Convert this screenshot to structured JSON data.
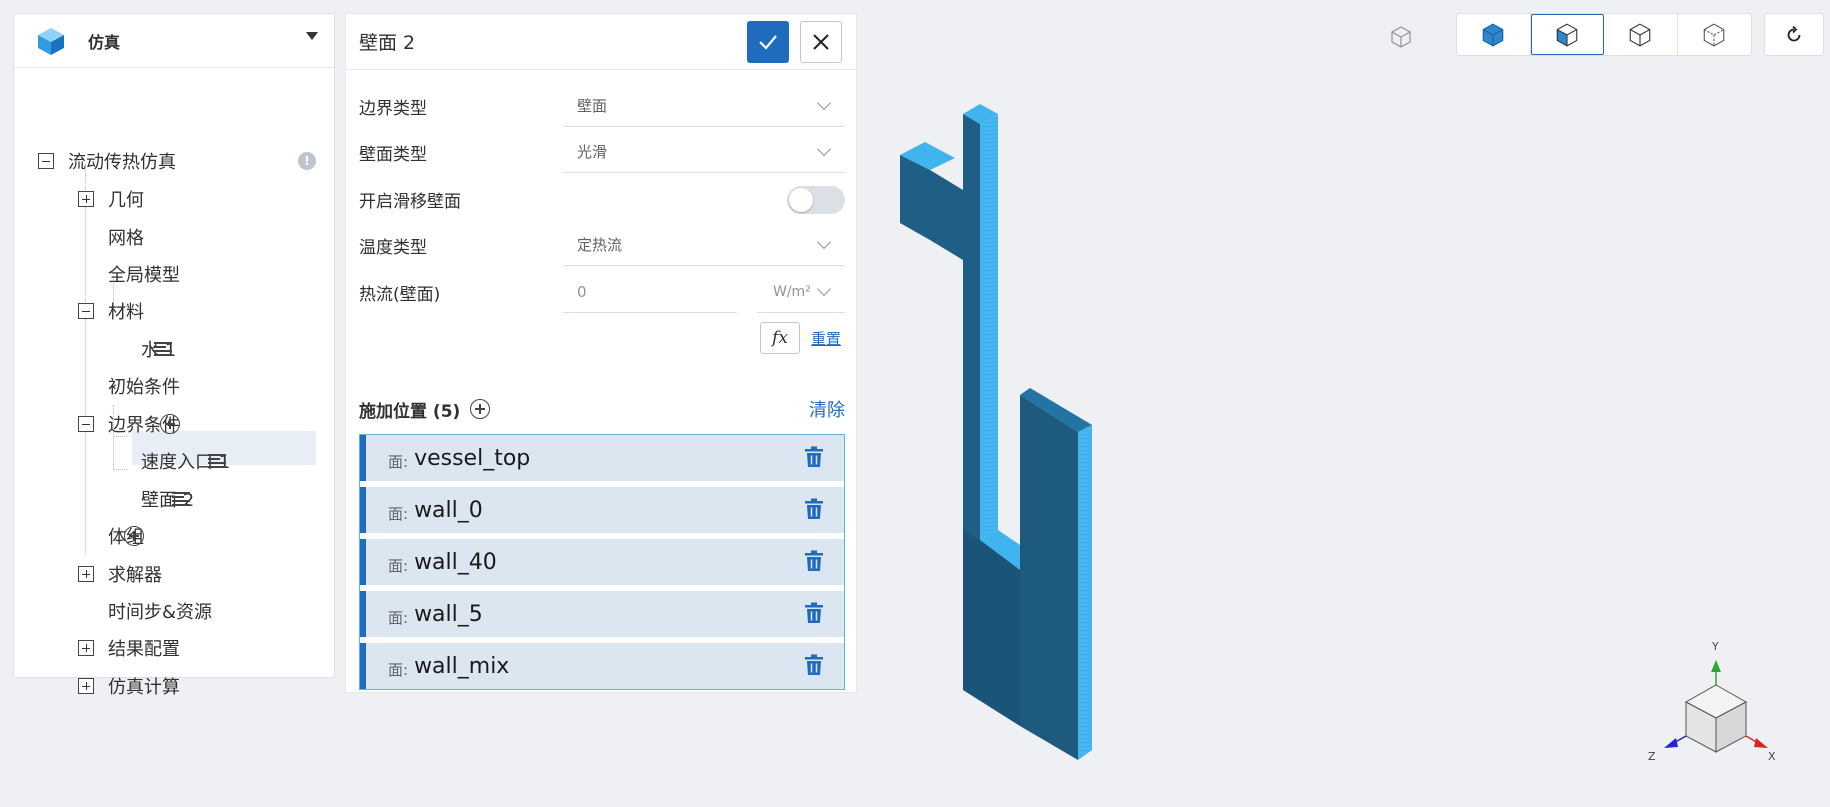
{
  "app": {
    "title": "仿真"
  },
  "tree": {
    "root": "流动传热仿真",
    "geometry": "几何",
    "mesh": "网格",
    "global_model": "全局模型",
    "materials": "材料",
    "water": "水 1",
    "initial_conditions": "初始条件",
    "boundary_conditions": "边界条件",
    "velocity_inlet": "速度入口 1",
    "wall": "壁面 2",
    "volume_group": "体组",
    "solver": "求解器",
    "timestep": "时间步&资源",
    "result_config": "结果配置",
    "sim_compute": "仿真计算"
  },
  "panel": {
    "title": "壁面 2",
    "boundary_type_label": "边界类型",
    "boundary_type_value": "壁面",
    "wall_type_label": "壁面类型",
    "wall_type_value": "光滑",
    "slip_wall_label": "开启滑移壁面",
    "slip_wall_enabled": false,
    "temp_type_label": "温度类型",
    "temp_type_value": "定热流",
    "heat_flux_label": "热流(壁面)",
    "heat_flux_placeholder": "0",
    "heat_flux_unit": "W/m²",
    "fx_label": "fx",
    "reset_label": "重置",
    "apply_title": "施加位置 (5)",
    "clear_label": "清除",
    "face_prefix": "面:",
    "faces": [
      "vessel_top",
      "wall_0",
      "wall_40",
      "wall_5",
      "wall_mix"
    ]
  },
  "axis_labels": {
    "x": "X",
    "y": "Y",
    "z": "Z"
  },
  "colors": {
    "primary": "#1e6bc0",
    "model_dark": "#1f5f85",
    "model_light": "#3fb4ef"
  },
  "icons": [
    "cube-icon",
    "check-icon",
    "close-icon",
    "warning-icon",
    "menu-icon",
    "add-circle-icon",
    "trash-icon",
    "reset-view-icon"
  ]
}
